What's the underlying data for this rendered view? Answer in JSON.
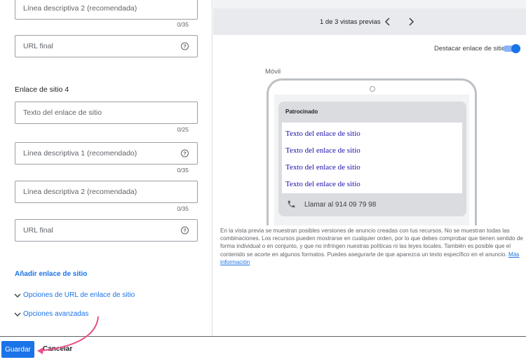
{
  "form": {
    "desc2_top": {
      "placeholder": "Línea descriptiva 2 (recomendada)",
      "counter": "0/35"
    },
    "url_top": {
      "placeholder": "URL final"
    },
    "section_title": "Enlace de sitio 4",
    "link_text": {
      "placeholder": "Texto del enlace de sitio",
      "counter": "0/25"
    },
    "desc1": {
      "placeholder": "Línea descriptiva 1 (recomendado)",
      "counter": "0/35"
    },
    "desc2": {
      "placeholder": "Línea descriptiva 2 (recomendada)",
      "counter": "0/35"
    },
    "url": {
      "placeholder": "URL final"
    },
    "add_link": "Añadir enlace de sitio",
    "url_options": "Opciones de URL de enlace de sitio",
    "advanced_options": "Opciones avanzadas"
  },
  "footer": {
    "save": "Guardar",
    "cancel": "Cancelar"
  },
  "preview": {
    "count": "1 de 3 vistas previas",
    "highlight_label": "Destacar enlace de sitio",
    "highlight_on": true,
    "mobile_label": "Móvil",
    "sponsored": "Patrocinado",
    "site_links": [
      "Texto del enlace de sitio",
      "Texto del enlace de sitio",
      "Texto del enlace de sitio",
      "Texto del enlace de sitio"
    ],
    "call": "Llamar al 914 09 79 98",
    "disclaimer": "En la vista previa se muestran posibles versiones de anuncio creadas con tus recursos. No se muestran todas las combinaciones. Los recursos pueden mostrarse en cualquier orden, por lo que debes comprobar que tienen sentido de forma individual o en conjunto, y que no infringen nuestras políticas ni las leyes locales. También es posible que el contenido se acorte en algunos formatos. Puedes asegurarte de que aparezca un texto específico en el anuncio.",
    "more_info": "Más información"
  },
  "colors": {
    "accent": "#1a73e8",
    "link": "#1a0dab",
    "annotation_arrow": "#e8508a"
  },
  "icons": [
    "help-icon",
    "chevron-left-icon",
    "chevron-right-icon",
    "chevron-down-icon",
    "phone-icon",
    "arrow-annotation-icon"
  ]
}
